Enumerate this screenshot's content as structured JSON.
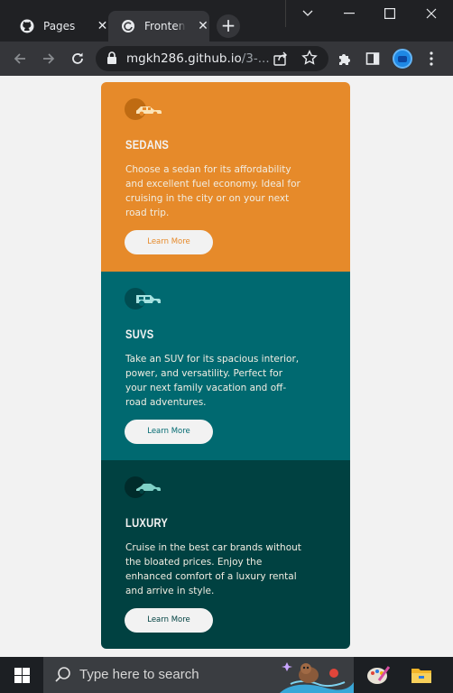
{
  "browser": {
    "tabs": [
      {
        "title": "Pages",
        "icon": "github-icon",
        "active": false
      },
      {
        "title": "Frontend",
        "icon": "loading-icon",
        "active": true
      }
    ],
    "close_glyph": "✕",
    "new_tab_glyph": "+",
    "url_host": "mgkh286.github.io",
    "url_rest": "/3-..."
  },
  "cards": [
    {
      "heading": "SEDANS",
      "text": "Choose a sedan for its affordability and excellent fuel economy. Ideal for cruising in the city or on your next road trip.",
      "button": "Learn More",
      "icon": "sedan-icon",
      "color": "#e68a2a"
    },
    {
      "heading": "SUVS",
      "text": "Take an SUV for its spacious interior, power, and versatility. Perfect for your next family vacation and off-road adventures.",
      "button": "Learn More",
      "icon": "suv-icon",
      "color": "#006970"
    },
    {
      "heading": "LUXURY",
      "text": "Cruise in the best car brands without the bloated prices. Enjoy the enhanced comfort of a luxury rental and arrive in style.",
      "button": "Learn More",
      "icon": "luxury-car-icon",
      "color": "#004141"
    }
  ],
  "taskbar": {
    "search_placeholder": "Type here to search"
  },
  "colors": {
    "page_bg": "#f2f2f2",
    "sedan": "#e68a2a",
    "suv": "#006970",
    "luxury": "#004141"
  }
}
